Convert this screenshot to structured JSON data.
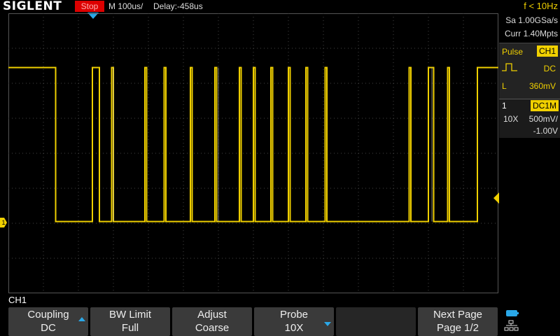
{
  "header": {
    "brand": "SIGLENT",
    "run_state": "Stop",
    "timebase": "M 100us/",
    "delay": "Delay:-458us",
    "frequency": "f < 10Hz"
  },
  "acquisition": {
    "sample_rate": "Sa 1.00GSa/s",
    "memory_depth": "Curr 1.40Mpts"
  },
  "trigger": {
    "type": "Pulse",
    "source": "CH1",
    "coupling": "DC",
    "level_label": "L",
    "level": "360mV"
  },
  "channel": {
    "number": "1",
    "coupling": "DC1M",
    "probe": "10X",
    "scale": "500mV/",
    "offset": "-1.00V",
    "marker": "1",
    "color": "#f0d000"
  },
  "waveform": {
    "high_level_div": 1.55,
    "low_level_div": 5.95,
    "description_unit": "divisions from top",
    "edges_div": [
      1.35,
      2.4,
      2.6,
      2.95,
      3.9,
      4.45,
      5.2,
      5.25,
      5.9,
      6.6,
      7.0,
      7.5,
      8.0,
      8.5,
      9.05,
      11.45,
      11.55,
      12.0,
      12.15,
      12.55,
      12.65,
      13.4
    ],
    "high_intervals_div": [
      [
        0,
        1.35
      ],
      [
        1.35,
        1.35
      ],
      [
        2.4,
        2.6
      ],
      [
        2.95,
        3.0
      ],
      [
        3.9,
        3.95
      ],
      [
        4.45,
        4.5
      ],
      [
        5.2,
        5.25
      ],
      [
        5.9,
        5.95
      ],
      [
        6.6,
        6.65
      ],
      [
        7.0,
        7.05
      ],
      [
        7.5,
        7.55
      ],
      [
        8.0,
        8.05
      ],
      [
        8.5,
        8.55
      ],
      [
        9.05,
        9.1
      ],
      [
        11.45,
        11.5
      ],
      [
        12.0,
        12.15
      ],
      [
        12.55,
        12.6
      ],
      [
        13.4,
        14.0
      ]
    ]
  },
  "menu": {
    "title": "CH1",
    "softkeys": [
      {
        "line1": "Coupling",
        "line2": "DC",
        "arrow": "up"
      },
      {
        "line1": "BW Limit",
        "line2": "Full",
        "arrow": ""
      },
      {
        "line1": "Adjust",
        "line2": "Coarse",
        "arrow": ""
      },
      {
        "line1": "Probe",
        "line2": "10X",
        "arrow": "down"
      },
      {
        "line1": "",
        "line2": "",
        "arrow": ""
      },
      {
        "line1": "Next Page",
        "line2": "Page 1/2",
        "arrow": ""
      }
    ]
  },
  "colors": {
    "accent": "#2aa8e8",
    "trace": "#f0d000",
    "stop": "#dd0000"
  }
}
